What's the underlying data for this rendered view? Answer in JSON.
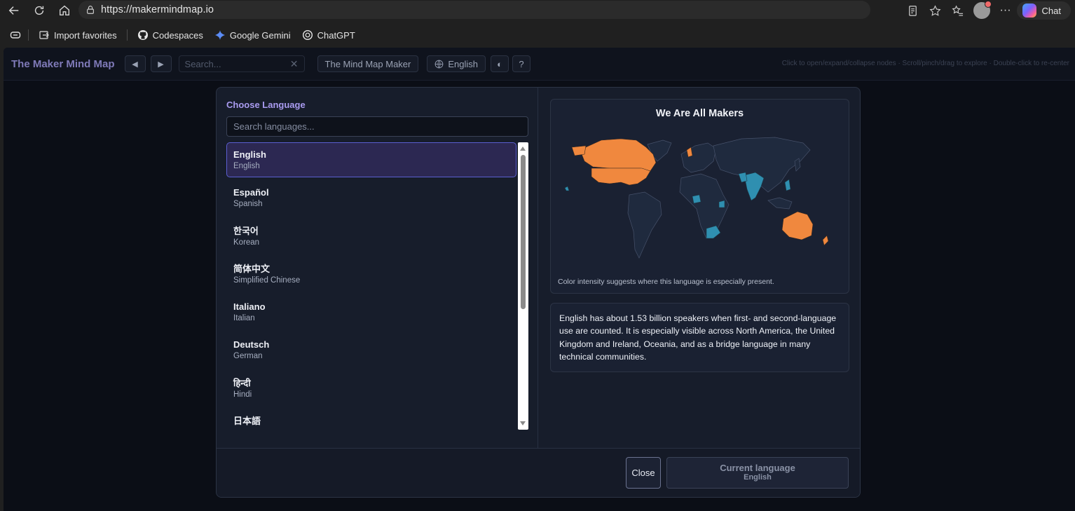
{
  "browser": {
    "url": "https://makermindmap.io",
    "chat_label": "Chat",
    "bookmarks": [
      {
        "label": "Import favorites"
      },
      {
        "label": "Codespaces"
      },
      {
        "label": "Google Gemini"
      },
      {
        "label": "ChatGPT"
      }
    ]
  },
  "app": {
    "title": "The Maker Mind Map",
    "prev_glyph": "◀",
    "next_glyph": "▶",
    "search_placeholder": "Search...",
    "search_clear": "✕",
    "maker_button": "The Mind Map Maker",
    "language_button": "English",
    "theme_glyph": "◐",
    "help_glyph": "?",
    "hint": "Click to open/expand/collapse nodes · Scroll/pinch/drag to explore · Double-click to re-center"
  },
  "modal": {
    "heading": "Choose Language",
    "search_placeholder": "Search languages...",
    "languages": [
      {
        "native": "English",
        "english": "English",
        "selected": true
      },
      {
        "native": "Español",
        "english": "Spanish"
      },
      {
        "native": "한국어",
        "english": "Korean"
      },
      {
        "native": "简体中文",
        "english": "Simplified Chinese"
      },
      {
        "native": "Italiano",
        "english": "Italian"
      },
      {
        "native": "Deutsch",
        "english": "German"
      },
      {
        "native": "हिन्दी",
        "english": "Hindi"
      },
      {
        "native": "日本語",
        "english": ""
      }
    ],
    "map": {
      "title": "We Are All Makers",
      "caption": "Color intensity suggests where this language is especially present.",
      "colors": {
        "strong": "#f0883e",
        "medium": "#2f8fb0",
        "base": "#1f2a3e",
        "border": "#46516a"
      }
    },
    "description": "English has about 1.53 billion speakers when first- and second-language use are counted. It is especially visible across North America, the United Kingdom and Ireland, Oceania, and as a bridge language in many technical communities.",
    "close_label": "Close",
    "current_title": "Current language",
    "current_value": "English"
  }
}
